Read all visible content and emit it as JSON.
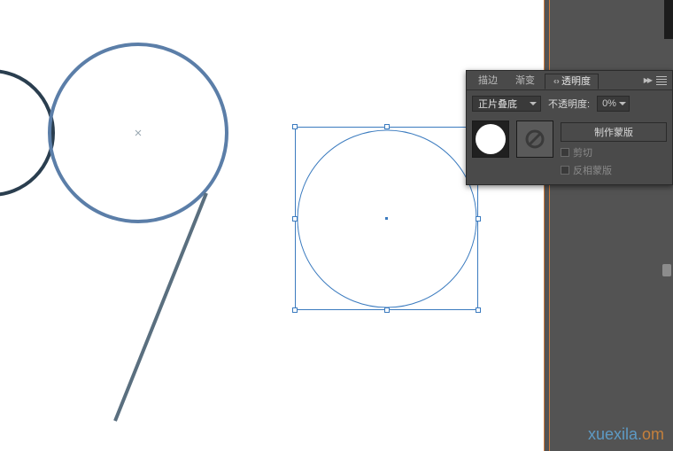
{
  "panel": {
    "tabs": {
      "stroke": "描边",
      "gradient": "渐变",
      "transparency": "透明度"
    },
    "blend_mode": {
      "label": "正片叠底"
    },
    "opacity": {
      "label": "不透明度:",
      "value": "0%"
    },
    "mask": {
      "make": "制作蒙版",
      "clip": "剪切",
      "invert": "反相蒙版"
    }
  },
  "icons": {
    "link": "link-icon",
    "flyout": "flyout-arrows",
    "menu": "hamburger-icon",
    "dropdown": "chevron-down-icon",
    "none": "no-symbol-icon"
  },
  "watermark": {
    "base": "xuexila.",
    "dom": "om"
  },
  "selection": {
    "shape": "ellipse",
    "stroke": "#3b7bbf"
  },
  "colors": {
    "panel_bg": "#4a4a4a",
    "canvas_bg": "#ffffff",
    "app_bg": "#535353",
    "selection": "#3b7bbf",
    "ruler": "#d07a3a"
  }
}
